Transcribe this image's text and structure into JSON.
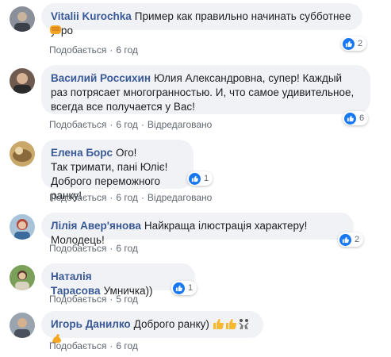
{
  "comments": [
    {
      "author": "Vitalii Kurochka",
      "text": "Пример как правильно начинать субботнее утро",
      "like": "Подобається",
      "time": "6 год",
      "reactions": "2",
      "emoji": "fist"
    },
    {
      "author": "Василий Россихин",
      "text": "Юлия Александровна, супер! Каждый раз потрясает многогранностью. И, что самое удивительное, всегда все получается у Вас!",
      "like": "Подобається",
      "time": "6 год",
      "edited": "Відредаговано",
      "reactions": "6"
    },
    {
      "author": "Елена Борс",
      "line1": "Ого!",
      "line2": "Так тримати, пані Юліє!",
      "line3": "Доброго переможного ранку!",
      "like": "Подобається",
      "time": "6 год",
      "edited": "Відредаговано",
      "reactions": "1"
    },
    {
      "author": "Лілія Авер'янова",
      "text": "Найкраща ілюстрація характеру! Молодець!",
      "like": "Подобається",
      "time": "6 год",
      "reactions": "2"
    },
    {
      "author": "Наталія Тарасова",
      "text": "Умничка))",
      "like": "Подобається",
      "time": "5 год",
      "reactions": "1"
    },
    {
      "author": "Игорь Данилко",
      "text": "Доброго ранку)",
      "like": "Подобається",
      "time": "6 год",
      "emojis": [
        "thumbs-up",
        "thumbs-up",
        "dancers",
        "muscle"
      ]
    }
  ],
  "colors": {
    "author": "#385898",
    "bubble": "#f0f2f5",
    "like": "#1877f2",
    "meta": "#606770"
  }
}
